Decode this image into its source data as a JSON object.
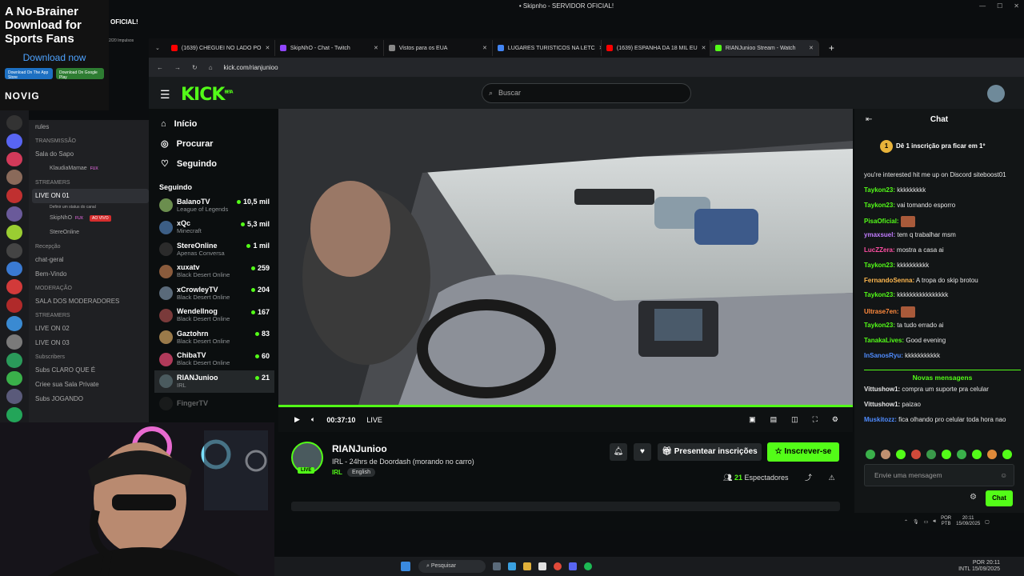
{
  "ad": {
    "headline": "A No-Brainer Download for Sports Fans",
    "cta": "Download now",
    "badge_apple": "Download On The App Store",
    "badge_google": "Download On Google Play",
    "brand": "NOVIG"
  },
  "os": {
    "window_title": "• Skipnho - SERVIDOR OFICIAL!"
  },
  "discord": {
    "server_name": "OFICIAL!",
    "server_sub": "2/20 Impulsos",
    "channels": [
      {
        "type": "channel",
        "label": "rules"
      },
      {
        "type": "category",
        "label": "TRANSMISSÃO"
      },
      {
        "type": "channel",
        "label": "Sala do Sapo"
      },
      {
        "type": "user",
        "label": "KlaudiaMamae",
        "tag": "FUX"
      },
      {
        "type": "category",
        "label": "STREAMERS"
      },
      {
        "type": "selected",
        "label": "LIVE ON 01"
      },
      {
        "type": "status",
        "label": "Definir um status do canal"
      },
      {
        "type": "user",
        "label": "SkipNhO",
        "tag": "FUX",
        "live": "AO VIVO"
      },
      {
        "type": "user",
        "label": "StereOnline"
      },
      {
        "type": "category",
        "label": "Recepção"
      },
      {
        "type": "channel",
        "label": "chat-geral"
      },
      {
        "type": "channel",
        "label": "Bem-Vindo"
      },
      {
        "type": "category",
        "label": "MODERAÇÃO"
      },
      {
        "type": "channel",
        "label": "SALA DOS MODERADORES"
      },
      {
        "type": "category",
        "label": "STREAMERS"
      },
      {
        "type": "channel",
        "label": "LIVE ON 02"
      },
      {
        "type": "channel",
        "label": "LIVE ON 03"
      },
      {
        "type": "category",
        "label": "Subscribers"
      },
      {
        "type": "channel",
        "label": "Subs CLARO QUE É"
      },
      {
        "type": "channel",
        "label": "Criee sua Sala Private"
      },
      {
        "type": "channel",
        "label": "Subs JOGANDO"
      }
    ]
  },
  "browser": {
    "tabs": [
      {
        "label": "(1639) CHEGUEI NO LADO PO",
        "color": "#ff0000"
      },
      {
        "label": "SkipNhO - Chat - Twitch",
        "color": "#9146ff"
      },
      {
        "label": "Vistos para os EUA",
        "color": "#888888"
      },
      {
        "label": "LUGARES TURISTICOS NA LETC",
        "color": "#4285f4"
      },
      {
        "label": "(1639) ESPANHA DA 18 MIL EU",
        "color": "#ff0000"
      },
      {
        "label": "RIANJunioo Stream - Watch",
        "color": "#53fc18",
        "active": true
      }
    ],
    "new_tab": "+",
    "url": "kick.com/rianjunioo"
  },
  "kick": {
    "logo": "KICK",
    "logo_sup": "BETA",
    "search_placeholder": "Buscar",
    "nav": [
      {
        "icon": "home-icon",
        "glyph": "⌂",
        "label": "Início"
      },
      {
        "icon": "compass-icon",
        "glyph": "◎",
        "label": "Procurar"
      },
      {
        "icon": "heart-icon",
        "glyph": "♡",
        "label": "Seguindo"
      }
    ],
    "following_title": "Seguindo",
    "following": [
      {
        "name": "BalanoTV",
        "game": "League of Legends",
        "viewers": "10,5 mil",
        "color": "#6b8e4e"
      },
      {
        "name": "xQc",
        "game": "Minecraft",
        "viewers": "5,3 mil",
        "color": "#3c5e85"
      },
      {
        "name": "StereOnline",
        "game": "Apenas Conversa",
        "viewers": "1 mil",
        "color": "#2b2b2b"
      },
      {
        "name": "xuxatv",
        "game": "Black Desert Online",
        "viewers": "259",
        "color": "#8a5b3c"
      },
      {
        "name": "xCrowleyTV",
        "game": "Black Desert Online",
        "viewers": "204",
        "color": "#5a6a7a"
      },
      {
        "name": "WendelInog",
        "game": "Black Desert Online",
        "viewers": "167",
        "color": "#7a3a3a"
      },
      {
        "name": "Gaztohrn",
        "game": "Black Desert Online",
        "viewers": "83",
        "color": "#9a7a4a"
      },
      {
        "name": "ChibaTV",
        "game": "Black Desert Online",
        "viewers": "60",
        "color": "#b03a5a"
      },
      {
        "name": "RIANJunioo",
        "game": "IRL",
        "viewers": "21",
        "color": "#4a5a5e",
        "selected": true
      },
      {
        "name": "FingerTV",
        "game": "",
        "viewers": "",
        "color": "#333333"
      }
    ],
    "player": {
      "time": "00:37:10",
      "live": "LIVE"
    },
    "channel": {
      "name": "RIANJunioo",
      "title": "IRL - 24hrs de Doordash (morando no carro)",
      "category": "IRL",
      "language": "English",
      "live_tag": "LIVE",
      "gift_label": "Presentear inscrições",
      "subscribe_label": "Inscrever-se",
      "viewers": "21",
      "viewers_label": "Espectadores"
    },
    "chat": {
      "title": "Chat",
      "pinned_rank": "1",
      "pinned": "Dê 1 inscrição pra ficar em 1º",
      "messages": [
        {
          "user": "",
          "text": "you're interested hit me up on Discord siteboost01",
          "color": "#e6e6e6"
        },
        {
          "user": "Taykon23:",
          "text": "kkkkkkkkk",
          "color": "#53fc18"
        },
        {
          "user": "Taykon23:",
          "text": "vai tomando esporro",
          "color": "#53fc18"
        },
        {
          "user": "PisaOficial:",
          "text": "",
          "color": "#53fc18",
          "emote": true
        },
        {
          "user": "ymaxsuel:",
          "text": "tem q trabalhar msm",
          "color": "#c27cff"
        },
        {
          "user": "LucZZera:",
          "text": "mostra a casa ai",
          "color": "#ff4fa3"
        },
        {
          "user": "Taykon23:",
          "text": "kkkkkkkkkk",
          "color": "#53fc18"
        },
        {
          "user": "FernandoSenna:",
          "text": "A tropa do skip brotou",
          "color": "#ffb84f"
        },
        {
          "user": "Taykon23:",
          "text": "kkkkkkkkkkkkkkkk",
          "color": "#53fc18"
        },
        {
          "user": "Ultrase7en:",
          "text": "",
          "color": "#ff8a3d",
          "emote": true
        },
        {
          "user": "Taykon23:",
          "text": "ta tudo errado ai",
          "color": "#53fc18"
        },
        {
          "user": "TanakaLives:",
          "text": "Good evening",
          "color": "#53fc18"
        },
        {
          "user": "InSanosRyu:",
          "text": "kkkkkkkkkkk",
          "color": "#4f8cff"
        }
      ],
      "new_messages_label": "Novas mensagens",
      "new_messages": [
        {
          "user": "Vittushow1:",
          "text": "compra um suporte pra celular",
          "color": "#e6e6e6"
        },
        {
          "user": "Vittushow1:",
          "text": "paizao",
          "color": "#e6e6e6"
        },
        {
          "user": "Muskitozz:",
          "text": "fica olhando pro celular toda hora nao",
          "color": "#4f8cff"
        }
      ],
      "input_placeholder": "Envie uma mensagem",
      "send_label": "Chat"
    }
  },
  "tray": {
    "lang1": "POR",
    "lang2": "PTB",
    "time": "20:11",
    "date": "15/09/2025"
  },
  "taskbar": {
    "search_label": "Pesquisar",
    "lang1": "POR",
    "lang2": "INTL",
    "time": "20:11",
    "date": "15/09/2025"
  }
}
